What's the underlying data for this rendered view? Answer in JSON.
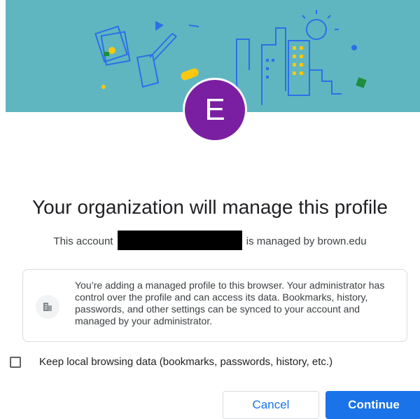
{
  "dialog": {
    "avatar_letter": "E",
    "title": "Your organization will manage this profile",
    "account_prefix": "This account",
    "account_suffix": "is managed by brown.edu",
    "info_text": "You’re adding a managed profile to this browser. Your administrator has control over the profile and can access its data. Bookmarks, history, passwords, and other settings can be synced to your account and managed by your administrator.",
    "checkbox_label": "Keep local browsing data (bookmarks, passwords, history, etc.)",
    "checkbox_checked": false,
    "cancel_label": "Cancel",
    "continue_label": "Continue"
  },
  "icons": {
    "info": "building-icon"
  },
  "colors": {
    "banner": "#5fb6c0",
    "avatar": "#7b1fa2",
    "accent": "#1a73e8"
  }
}
